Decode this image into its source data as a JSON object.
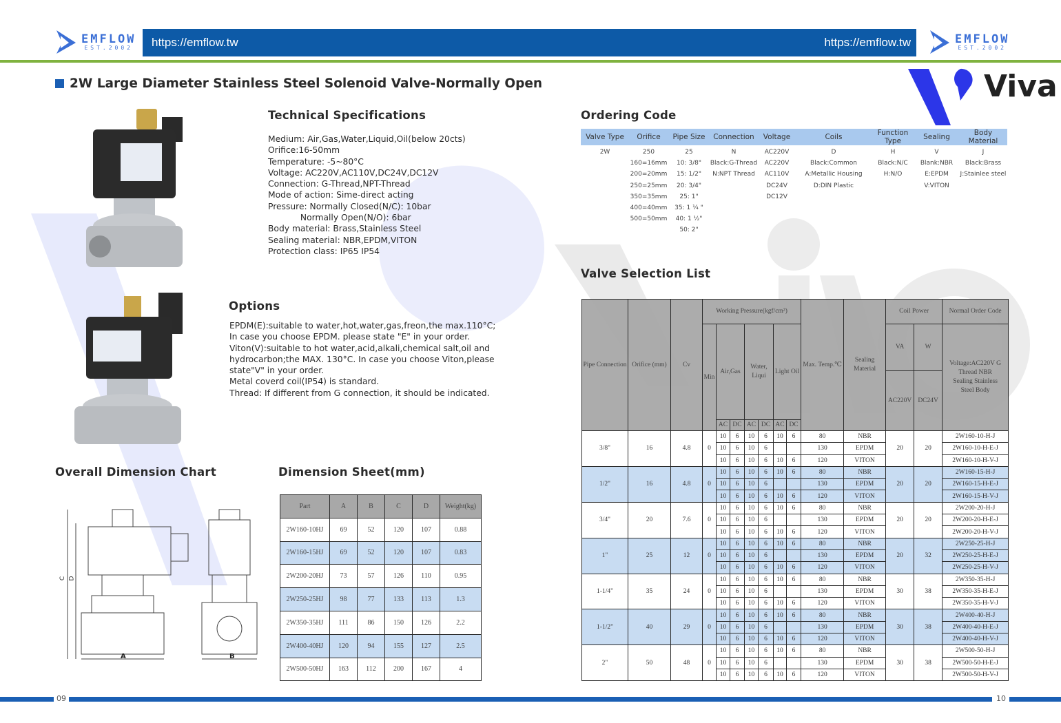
{
  "header": {
    "url_left": "https://emflow.tw",
    "url_right": "https://emflow.tw",
    "logo": {
      "word": "EMFLOW",
      "est": "EST.2002"
    },
    "watermark_brand": "Viva",
    "colors": {
      "bar": "#0d5aa7",
      "accent_line": "#7fb23f",
      "row_highlight": "#c8dcf2",
      "ordering_header": "#a9c9ee"
    }
  },
  "page_title": "2W Large Diameter  Stainless Steel Solenoid Valve-Normally Open",
  "tech_specs": {
    "heading": "Technical Specifications",
    "lines": [
      "Medium: Air,Gas,Water,Liquid,Oil(below 20cts)",
      "Orifice:16-50mm",
      "Temperature: -5~80°C",
      "Voltage: AC220V,AC110V,DC24V,DC12V",
      "Connection: G-Thread,NPT-Thread",
      "Mode of action: Sime-direct acting",
      "Pressure: Normally Closed(N/C): 10bar",
      "            Normally Open(N/O): 6bar",
      "Body material: Brass,Stainless Steel",
      "Sealing material: NBR,EPDM,VITON",
      "Protection class: IP65 IP54"
    ]
  },
  "options": {
    "heading": "Options",
    "lines": [
      "EPDM(E):suitable to water,hot,water,gas,freon,the max.110°C;",
      "In case you choose EPDM. please state \"E\" in your order.",
      "Viton(V):suitable to hot water,acid,alkali,chemical salt,oil and",
      "hydrocarbon;the MAX. 130°C. In case you choose Viton,please",
      "state\"V\" in your order.",
      "Metal coverd coil(IP54) is standard.",
      "Thread: If different from G connection, it should be indicated."
    ]
  },
  "dimension_chart": {
    "heading": "Overall Dimension Chart",
    "labels": [
      "A",
      "B",
      "C",
      "D"
    ]
  },
  "dimension_sheet": {
    "heading": "Dimension Sheet(mm)",
    "columns": [
      "Part",
      "A",
      "B",
      "C",
      "D",
      "Weight(kg)"
    ],
    "rows": [
      [
        "2W160-10HJ",
        "69",
        "52",
        "120",
        "107",
        "0.88"
      ],
      [
        "2W160-15HJ",
        "69",
        "52",
        "120",
        "107",
        "0.83"
      ],
      [
        "2W200-20HJ",
        "73",
        "57",
        "126",
        "110",
        "0.95"
      ],
      [
        "2W250-25HJ",
        "98",
        "77",
        "133",
        "113",
        "1.3"
      ],
      [
        "2W350-35HJ",
        "111",
        "86",
        "150",
        "126",
        "2.2"
      ],
      [
        "2W400-40HJ",
        "120",
        "94",
        "155",
        "127",
        "2.5"
      ],
      [
        "2W500-50HJ",
        "163",
        "112",
        "200",
        "167",
        "4"
      ]
    ]
  },
  "ordering_code": {
    "heading": "Ordering Code",
    "columns": [
      {
        "label": "Valve Type",
        "values": [
          "2W"
        ]
      },
      {
        "label": "Orifice",
        "values": [
          "250",
          "160=16mm",
          "200=20mm",
          "250=25mm",
          "350=35mm",
          "400=40mm",
          "500=50mm"
        ]
      },
      {
        "label": "Pipe Size",
        "values": [
          "25",
          "10: 3/8\"",
          "15: 1/2\"",
          "20: 3/4\"",
          "25: 1\"",
          "35: 1 ¼ \"",
          "40: 1 ½\"",
          "50:  2\""
        ]
      },
      {
        "label": "Connection",
        "values": [
          "N",
          "Black:G-Thread",
          "N:NPT Thread"
        ]
      },
      {
        "label": "Voltage",
        "values": [
          "AC220V",
          "AC220V",
          "AC110V",
          "DC24V",
          "DC12V"
        ]
      },
      {
        "label": "Coils",
        "values": [
          "D",
          "Black:Common",
          "A:Metallic Housing",
          "D:DIN Plastic"
        ]
      },
      {
        "label": "Function Type",
        "values": [
          "H",
          "Black:N/C",
          "H:N/O"
        ]
      },
      {
        "label": "Sealing",
        "values": [
          "V",
          "Blank:NBR",
          "E:EPDM",
          "V:VITON"
        ]
      },
      {
        "label": "Body Material",
        "values": [
          "J",
          "Black:Brass",
          "J:Stainlee steel"
        ]
      }
    ]
  },
  "valve_selection": {
    "heading": "Valve Selection List",
    "headers": {
      "pipe": "Pipe Connection",
      "orifice": "Orifice (mm)",
      "cv": "Cv",
      "working_pressure": "Working Pressure(kgf/cm²)",
      "min": "Min",
      "air_gas": "Air,Gas",
      "water": "Water, Liqui",
      "light_oil": "Light Oil",
      "ac": "AC",
      "dc": "DC",
      "max_temp": "Max. Temp.℃",
      "sealing": "Sealing Material",
      "coil_power": "Coil Power",
      "va": "VA",
      "w": "W",
      "ac220v": "AC220V",
      "dc24v": "DC24V",
      "order_code": "Normal Order Code",
      "order_code_note": "Voltage:AC220V G Thread NBR Sealing Stainless Steel Body"
    },
    "groups": [
      {
        "pipe": "3/8\"",
        "orifice": "16",
        "cv": "4.8",
        "min": "0",
        "va": "20",
        "w": "20",
        "rows": [
          {
            "p": [
              "10",
              "6",
              "10",
              "6",
              "10",
              "6"
            ],
            "temp": "80",
            "seal": "NBR",
            "code": "2W160-10-H-J"
          },
          {
            "p": [
              "10",
              "6",
              "10",
              "6",
              "",
              ""
            ],
            "temp": "130",
            "seal": "EPDM",
            "code": "2W160-10-H-E-J"
          },
          {
            "p": [
              "10",
              "6",
              "10",
              "6",
              "10",
              "6"
            ],
            "temp": "120",
            "seal": "VITON",
            "code": "2W160-10-H-V-J"
          }
        ]
      },
      {
        "pipe": "1/2\"",
        "orifice": "16",
        "cv": "4.8",
        "min": "0",
        "va": "20",
        "w": "20",
        "rows": [
          {
            "p": [
              "10",
              "6",
              "10",
              "6",
              "10",
              "6"
            ],
            "temp": "80",
            "seal": "NBR",
            "code": "2W160-15-H-J"
          },
          {
            "p": [
              "10",
              "6",
              "10",
              "6",
              "",
              ""
            ],
            "temp": "130",
            "seal": "EPDM",
            "code": "2W160-15-H-E-J"
          },
          {
            "p": [
              "10",
              "6",
              "10",
              "6",
              "10",
              "6"
            ],
            "temp": "120",
            "seal": "VITON",
            "code": "2W160-15-H-V-J"
          }
        ]
      },
      {
        "pipe": "3/4\"",
        "orifice": "20",
        "cv": "7.6",
        "min": "0",
        "va": "20",
        "w": "20",
        "rows": [
          {
            "p": [
              "10",
              "6",
              "10",
              "6",
              "10",
              "6"
            ],
            "temp": "80",
            "seal": "NBR",
            "code": "2W200-20-H-J"
          },
          {
            "p": [
              "10",
              "6",
              "10",
              "6",
              "",
              ""
            ],
            "temp": "130",
            "seal": "EPDM",
            "code": "2W200-20-H-E-J"
          },
          {
            "p": [
              "10",
              "6",
              "10",
              "6",
              "10",
              "6"
            ],
            "temp": "120",
            "seal": "VITON",
            "code": "2W200-20-H-V-J"
          }
        ]
      },
      {
        "pipe": "1\"",
        "orifice": "25",
        "cv": "12",
        "min": "0",
        "va": "20",
        "w": "32",
        "rows": [
          {
            "p": [
              "10",
              "6",
              "10",
              "6",
              "10",
              "6"
            ],
            "temp": "80",
            "seal": "NBR",
            "code": "2W250-25-H-J"
          },
          {
            "p": [
              "10",
              "6",
              "10",
              "6",
              "",
              ""
            ],
            "temp": "130",
            "seal": "EPDM",
            "code": "2W250-25-H-E-J"
          },
          {
            "p": [
              "10",
              "6",
              "10",
              "6",
              "10",
              "6"
            ],
            "temp": "120",
            "seal": "VITON",
            "code": "2W250-25-H-V-J"
          }
        ]
      },
      {
        "pipe": "1-1/4\"",
        "orifice": "35",
        "cv": "24",
        "min": "0",
        "va": "30",
        "w": "38",
        "rows": [
          {
            "p": [
              "10",
              "6",
              "10",
              "6",
              "10",
              "6"
            ],
            "temp": "80",
            "seal": "NBR",
            "code": "2W350-35-H-J"
          },
          {
            "p": [
              "10",
              "6",
              "10",
              "6",
              "",
              ""
            ],
            "temp": "130",
            "seal": "EPDM",
            "code": "2W350-35-H-E-J"
          },
          {
            "p": [
              "10",
              "6",
              "10",
              "6",
              "10",
              "6"
            ],
            "temp": "120",
            "seal": "VITON",
            "code": "2W350-35-H-V-J"
          }
        ]
      },
      {
        "pipe": "1-1/2\"",
        "orifice": "40",
        "cv": "29",
        "min": "0",
        "va": "30",
        "w": "38",
        "rows": [
          {
            "p": [
              "10",
              "6",
              "10",
              "6",
              "10",
              "6"
            ],
            "temp": "80",
            "seal": "NBR",
            "code": "2W400-40-H-J"
          },
          {
            "p": [
              "10",
              "6",
              "10",
              "6",
              "",
              ""
            ],
            "temp": "130",
            "seal": "EPDM",
            "code": "2W400-40-H-E-J"
          },
          {
            "p": [
              "10",
              "6",
              "10",
              "6",
              "10",
              "6"
            ],
            "temp": "120",
            "seal": "VITON",
            "code": "2W400-40-H-V-J"
          }
        ]
      },
      {
        "pipe": "2\"",
        "orifice": "50",
        "cv": "48",
        "min": "0",
        "va": "30",
        "w": "38",
        "rows": [
          {
            "p": [
              "10",
              "6",
              "10",
              "6",
              "10",
              "6"
            ],
            "temp": "80",
            "seal": "NBR",
            "code": "2W500-50-H-J"
          },
          {
            "p": [
              "10",
              "6",
              "10",
              "6",
              "",
              ""
            ],
            "temp": "130",
            "seal": "EPDM",
            "code": "2W500-50-H-E-J"
          },
          {
            "p": [
              "10",
              "6",
              "10",
              "6",
              "10",
              "6"
            ],
            "temp": "120",
            "seal": "VITON",
            "code": "2W500-50-H-V-J"
          }
        ]
      }
    ]
  },
  "footer": {
    "page_left": "09",
    "page_right": "10"
  }
}
